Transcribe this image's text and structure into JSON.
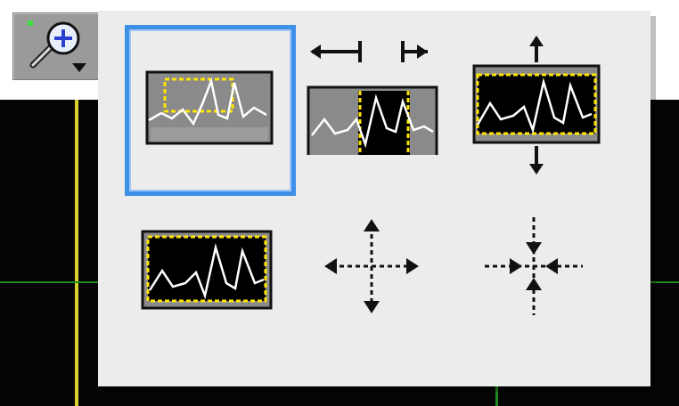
{
  "toolbar": {
    "zoom_tool": {
      "icon": "zoom-in-icon",
      "has_dropdown": true
    }
  },
  "zoom_palette": {
    "selected_index": 0,
    "tools": [
      {
        "id": "zoom-rectangle",
        "icon": "zoom-rectangle-icon"
      },
      {
        "id": "zoom-x-rectangle",
        "icon": "zoom-x-rectangle-icon"
      },
      {
        "id": "zoom-y-rectangle",
        "icon": "zoom-y-rectangle-icon"
      },
      {
        "id": "zoom-to-fit",
        "icon": "zoom-to-fit-icon"
      },
      {
        "id": "zoom-in-about-point",
        "icon": "zoom-in-point-icon"
      },
      {
        "id": "zoom-out-about-point",
        "icon": "zoom-out-point-icon"
      }
    ]
  },
  "colors": {
    "selection": "#3d8fe8",
    "plot_background": "#050505",
    "cursor_yellow": "#d9cf2a",
    "cursor_green": "#1f8a1f",
    "waveform": "#ffffff",
    "marquee": "#ffe600"
  }
}
